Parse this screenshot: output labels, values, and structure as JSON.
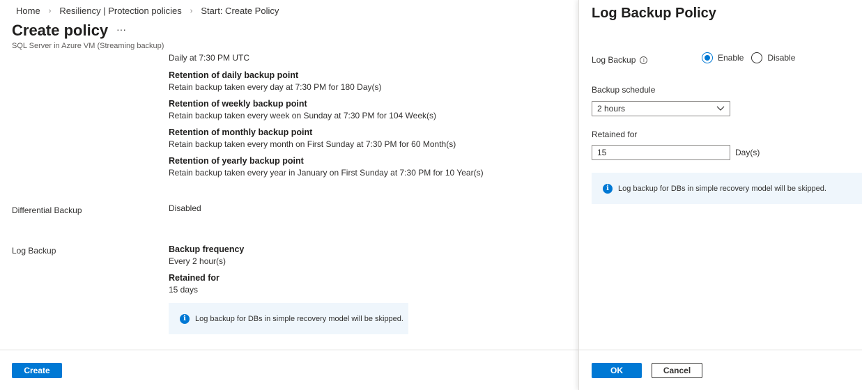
{
  "breadcrumb": [
    "Home",
    "Resiliency | Protection policies",
    "Start: Create Policy"
  ],
  "page": {
    "title": "Create policy",
    "more": "···",
    "subtitle": "SQL Server in Azure VM (Streaming backup)"
  },
  "full_backup": {
    "schedule": "Daily at 7:30 PM UTC",
    "retention": [
      {
        "heading": "Retention of daily backup point",
        "text": "Retain backup taken every day at 7:30 PM for 180 Day(s)"
      },
      {
        "heading": "Retention of weekly backup point",
        "text": "Retain backup taken every week on Sunday at 7:30 PM for 104 Week(s)"
      },
      {
        "heading": "Retention of monthly backup point",
        "text": "Retain backup taken every month on First Sunday at 7:30 PM for 60 Month(s)"
      },
      {
        "heading": "Retention of yearly backup point",
        "text": "Retain backup taken every year in January on First Sunday at 7:30 PM for 10 Year(s)"
      }
    ]
  },
  "differential": {
    "label": "Differential Backup",
    "value": "Disabled"
  },
  "log": {
    "label": "Log Backup",
    "freq_heading": "Backup frequency",
    "freq_value": "Every 2 hour(s)",
    "ret_heading": "Retained for",
    "ret_value": "15 days",
    "info": "Log backup for DBs in simple recovery model will be skipped."
  },
  "create_label": "Create",
  "panel": {
    "title": "Log Backup Policy",
    "log_label": "Log Backup",
    "enable": "Enable",
    "disable": "Disable",
    "enabled": true,
    "schedule_label": "Backup schedule",
    "schedule_value": "2 hours",
    "retained_label": "Retained for",
    "retained_value": "15",
    "retained_unit": "Day(s)",
    "info": "Log backup for DBs in simple recovery model will be skipped.",
    "ok": "OK",
    "cancel": "Cancel"
  },
  "colors": {
    "accent": "#0078d4",
    "info_bg": "#eff6fc"
  }
}
